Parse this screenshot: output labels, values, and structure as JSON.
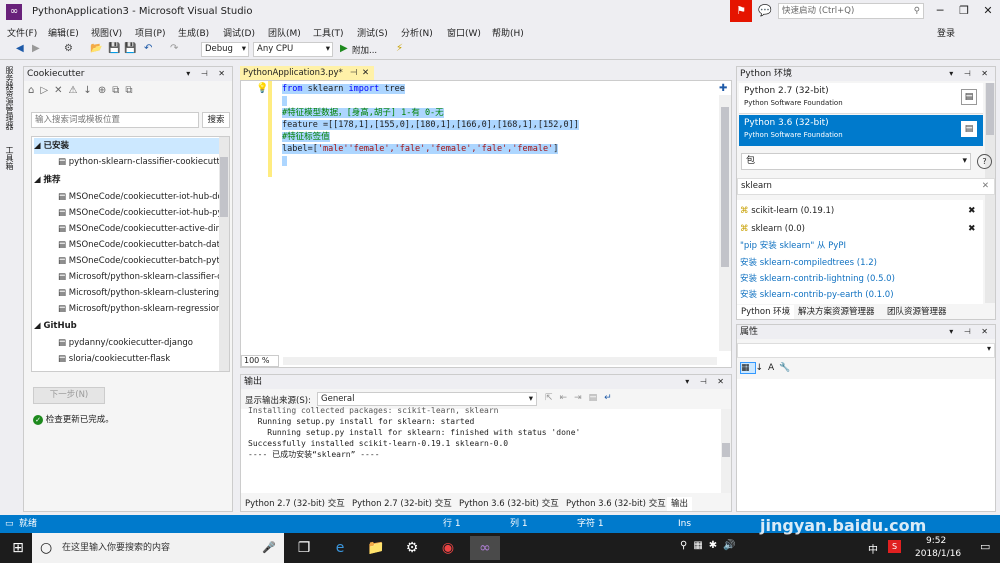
{
  "window": {
    "title": "PythonApplication3 - Microsoft Visual Studio",
    "quick_launch_placeholder": "快速启动 (Ctrl+Q)",
    "signin": "登录"
  },
  "menu": [
    "文件(F)",
    "编辑(E)",
    "视图(V)",
    "项目(P)",
    "生成(B)",
    "调试(D)",
    "团队(M)",
    "工具(T)",
    "测试(S)",
    "分析(N)",
    "窗口(W)",
    "帮助(H)"
  ],
  "toolbar": {
    "config": "Debug",
    "platform": "Any CPU",
    "attach": "附加..."
  },
  "side_tabs": [
    "服务器资源管理器",
    "工具箱"
  ],
  "cookiecutter": {
    "title": "Cookiecutter",
    "search_placeholder": "输入搜索词或模板位置",
    "search_button": "搜索",
    "groups": [
      {
        "label": "已安装",
        "items": [
          "python-sklearn-classifier-cookiecutter"
        ]
      },
      {
        "label": "推荐",
        "items": [
          "MSOneCode/cookiecutter-iot-hub-dotnet",
          "MSOneCode/cookiecutter-iot-hub-python",
          "MSOneCode/cookiecutter-active-directory",
          "MSOneCode/cookiecutter-batch-data",
          "MSOneCode/cookiecutter-batch-python",
          "Microsoft/python-sklearn-classifier-cookiecutter",
          "Microsoft/python-sklearn-clustering-cookiecutter",
          "Microsoft/python-sklearn-regression-cookiecutter"
        ]
      },
      {
        "label": "GitHub",
        "items": [
          "pydanny/cookiecutter-django",
          "sloria/cookiecutter-flask"
        ]
      }
    ],
    "next_button": "下一步(N)",
    "status": "检查更新已完成。"
  },
  "editor": {
    "tab_title": "PythonApplication3.py*",
    "zoom": "100 %",
    "lines": [
      [
        {
          "t": "from",
          "c": "kw"
        },
        {
          "t": " sklearn ",
          "c": ""
        },
        {
          "t": "import",
          "c": "kw"
        },
        {
          "t": " tree",
          "c": ""
        }
      ],
      [],
      [
        {
          "t": "#特征模型数据，[身高,胡子] 1-有 0-无",
          "c": "cm"
        }
      ],
      [
        {
          "t": "feature =[[178,1],[155,0],[180,1],[166,0],[168,1],[152,0]]",
          "c": ""
        }
      ],
      [
        {
          "t": "#特征标签值",
          "c": "cm"
        }
      ],
      [
        {
          "t": "label=[",
          "c": ""
        },
        {
          "t": "'male''female','fale','female','fale','female'",
          "c": "st"
        },
        {
          "t": "]",
          "c": ""
        }
      ],
      []
    ]
  },
  "output": {
    "title": "输出",
    "source_label": "显示输出来源(S):",
    "source_value": "General",
    "lines": [
      "Installing collected packages: scikit-learn, sklearn",
      "  Running setup.py install for sklearn: started",
      "    Running setup.py install for sklearn: finished with status 'done'",
      "Successfully installed scikit-learn-0.19.1 sklearn-0.0",
      "---- 已成功安装“sklearn” ----"
    ],
    "tabs": [
      "Python 2.7 (32-bit) 交互",
      "Python 2.7 (32-bit) 交互",
      "Python 3.6 (32-bit) 交互",
      "Python 3.6 (32-bit) 交互",
      "输出"
    ]
  },
  "python_env": {
    "title": "Python 环境",
    "envs": [
      {
        "name": "Python 2.7 (32-bit)",
        "vendor": "Python Software Foundation",
        "selected": false
      },
      {
        "name": "Python 3.6 (32-bit)",
        "vendor": "Python Software Foundation",
        "selected": true
      }
    ],
    "view": "包",
    "search_value": "sklearn",
    "packages": [
      "scikit-learn (0.19.1)",
      "sklearn (0.0)"
    ],
    "pypi_link": "\"pip 安装 sklearn\" 从 PyPI",
    "install_links": [
      "安装 sklearn-compiledtrees (1.2)",
      "安装 sklearn-contrib-lightning (0.5.0)",
      "安装 sklearn-contrib-py-earth (0.1.0)"
    ],
    "bottom_tabs": [
      "Python 环境",
      "解决方案资源管理器",
      "团队资源管理器"
    ]
  },
  "properties": {
    "title": "属性"
  },
  "statusbar": {
    "ready": "就绪",
    "line": "行 1",
    "col": "列 1",
    "char": "字符 1",
    "mode": "Ins"
  },
  "taskbar": {
    "search_placeholder": "在这里输入你要搜索的内容",
    "time": "9:52",
    "date": "2018/1/16",
    "ime": "中"
  },
  "watermark": {
    "text": "jingyan.baidu.com"
  },
  "colors": {
    "accent": "#007acc",
    "vs_purple": "#68217a",
    "taskbar": "#1c1c1c"
  }
}
